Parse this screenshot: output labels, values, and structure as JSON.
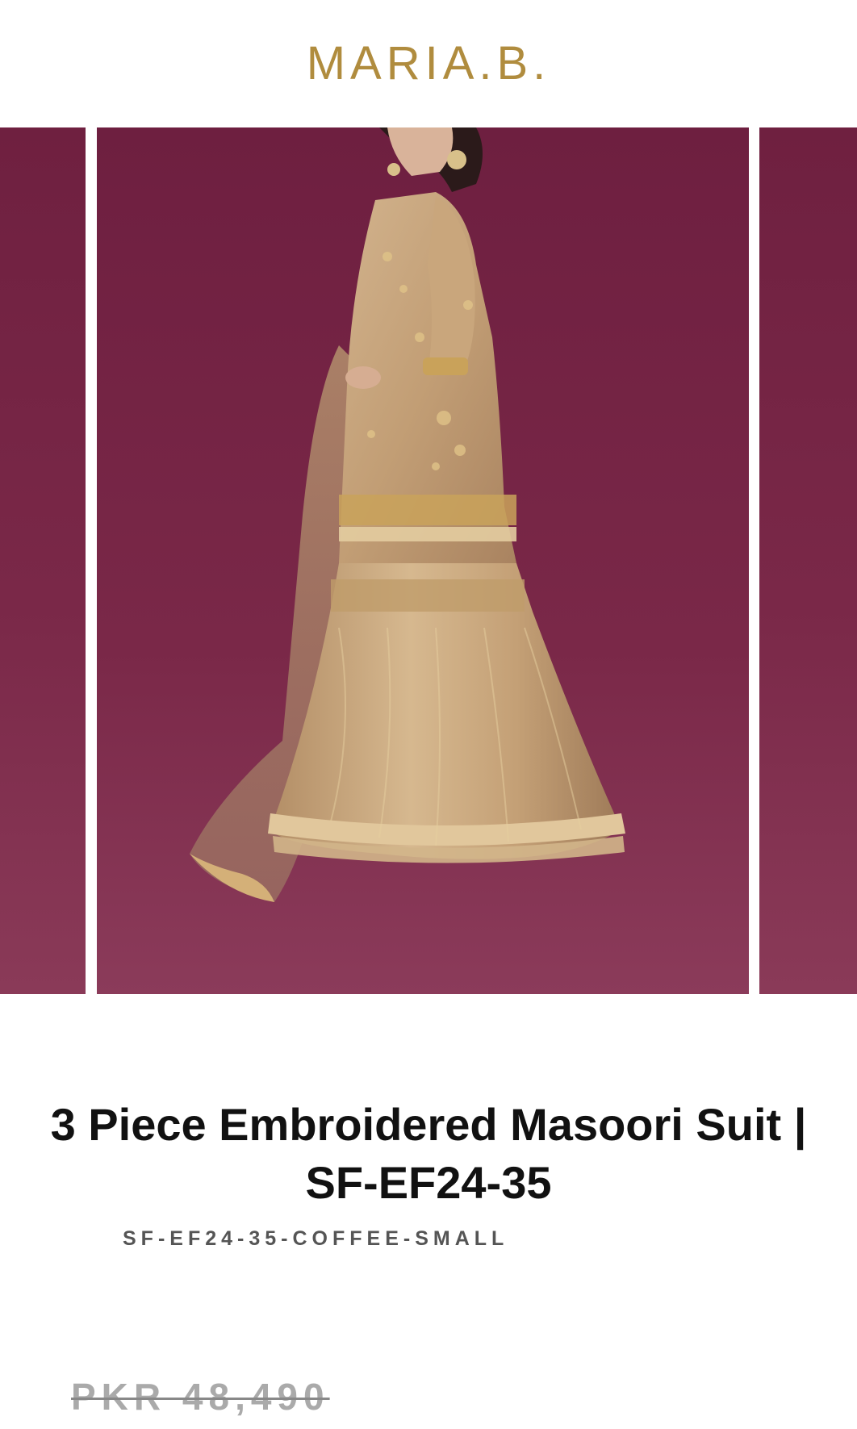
{
  "header": {
    "logo_text": "MARIA.B."
  },
  "carousel": {
    "slides": [
      "previous-image",
      "product-image",
      "next-image"
    ],
    "active_index": 1,
    "colors": {
      "background": "#762644",
      "fabric": "#c7a57f",
      "gold": "#c9a25a"
    }
  },
  "product": {
    "title_line1": "3 Piece Embroidered Masoori Suit |",
    "title_line2": "SF-EF24-35",
    "sku": "SF-EF24-35-COFFEE-SMALL",
    "original_price": "PKR 48,490"
  }
}
